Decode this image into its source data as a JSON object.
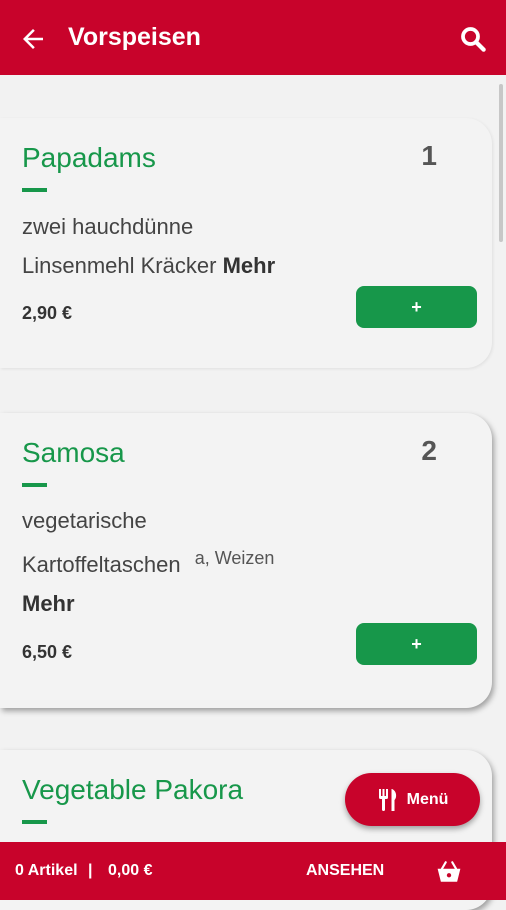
{
  "header": {
    "title": "Vorspeisen",
    "back_icon": "arrow-left-icon",
    "search_icon": "search-icon"
  },
  "dishes": [
    {
      "name": "Papadams",
      "number": "1",
      "desc_line1": "zwei hauchdünne",
      "desc_line2": "Linsenmehl Kräcker",
      "more": "Mehr",
      "price": "2,90 €",
      "add_label": "+"
    },
    {
      "name": "Samosa",
      "number": "2",
      "desc_line1": "vegetarische",
      "desc_line2": "Kartoffeltaschen",
      "allergens": "a, Weizen",
      "more": "Mehr",
      "price": "6,50 €",
      "add_label": "+"
    },
    {
      "name": "Vegetable Pakora"
    }
  ],
  "fab": {
    "label": "Menü",
    "icon": "cutlery-icon"
  },
  "cart": {
    "count": "0 Artikel",
    "separator": "|",
    "total": "0,00 €",
    "view_label": "ANSEHEN",
    "icon": "basket-icon"
  },
  "colors": {
    "brand_red": "#c8032b",
    "accent_green": "#17974a"
  }
}
